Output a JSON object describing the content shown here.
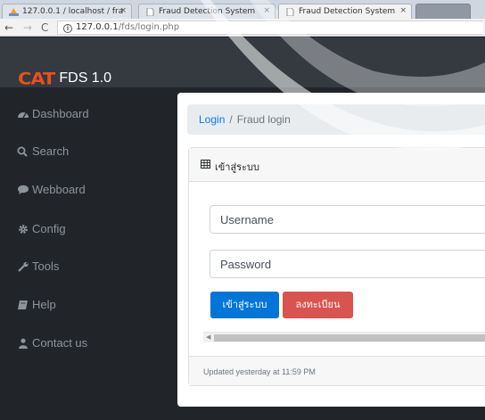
{
  "browser": {
    "tabs": [
      {
        "title": "127.0.0.1 / localhost / fra",
        "close": "×"
      },
      {
        "title": "Fraud Detection System",
        "close": "×"
      },
      {
        "title": "Fraud Detection System",
        "close": "×"
      }
    ],
    "url_host": "127.0.0.1",
    "url_path": "/fds/login.php",
    "nav": {
      "back": "←",
      "forward": "→",
      "reload": "C",
      "info": "i"
    }
  },
  "navbar": {
    "logo": "CAT",
    "app_name": "FDS 1.0"
  },
  "sidebar": {
    "items": [
      {
        "label": "Dashboard",
        "icon": "tachometer-icon"
      },
      {
        "label": "Search",
        "icon": "search-icon"
      },
      {
        "label": "Webboard",
        "icon": "comment-icon"
      },
      {
        "label": "Config",
        "icon": "gear-icon"
      },
      {
        "label": "Tools",
        "icon": "wrench-icon"
      },
      {
        "label": "Help",
        "icon": "book-icon"
      },
      {
        "label": "Contact us",
        "icon": "user-icon"
      }
    ]
  },
  "breadcrumb": {
    "link": "Login",
    "separator": "/",
    "current": "Fraud login"
  },
  "login_card": {
    "header": "เข้าสู่ระบบ",
    "username_placeholder": "Username",
    "password_placeholder": "Password",
    "login_button": "เข้าสู่ระบบ",
    "register_button": "ลงทะเบียน",
    "footer": "Updated yesterday at 11:59 PM"
  },
  "colors": {
    "accent_blue": "#0275d8",
    "danger_red": "#d9534f",
    "logo_orange": "#e8501c",
    "sidebar_bg": "#212529",
    "navbar_bg": "#343a40"
  }
}
